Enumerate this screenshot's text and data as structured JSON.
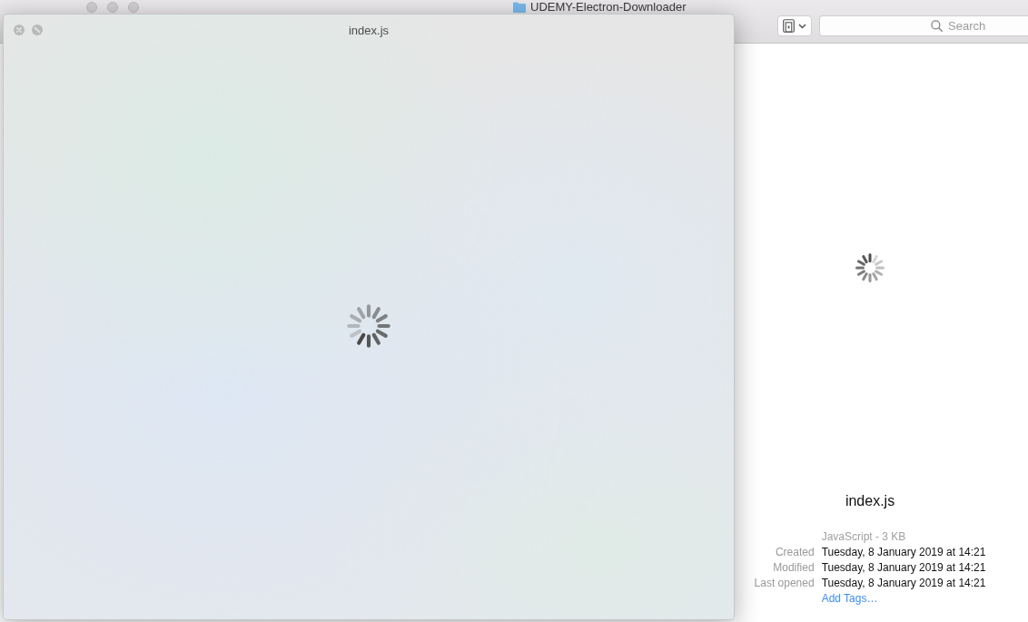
{
  "finder_window": {
    "title": "UDEMY-Electron-Downloader",
    "toolbar": {
      "search": {
        "placeholder": "Search"
      }
    },
    "preview": {
      "loading": true,
      "file_name": "index.js",
      "kind_size": "JavaScript - 3 KB",
      "details": [
        {
          "label": "Created",
          "value": "Tuesday, 8 January 2019 at 14:21"
        },
        {
          "label": "Modified",
          "value": "Tuesday, 8 January 2019 at 14:21"
        },
        {
          "label": "Last opened",
          "value": "Tuesday, 8 January 2019 at 14:21"
        }
      ],
      "add_tags": "Add Tags…"
    }
  },
  "quick_look": {
    "title": "index.js",
    "loading": true
  }
}
